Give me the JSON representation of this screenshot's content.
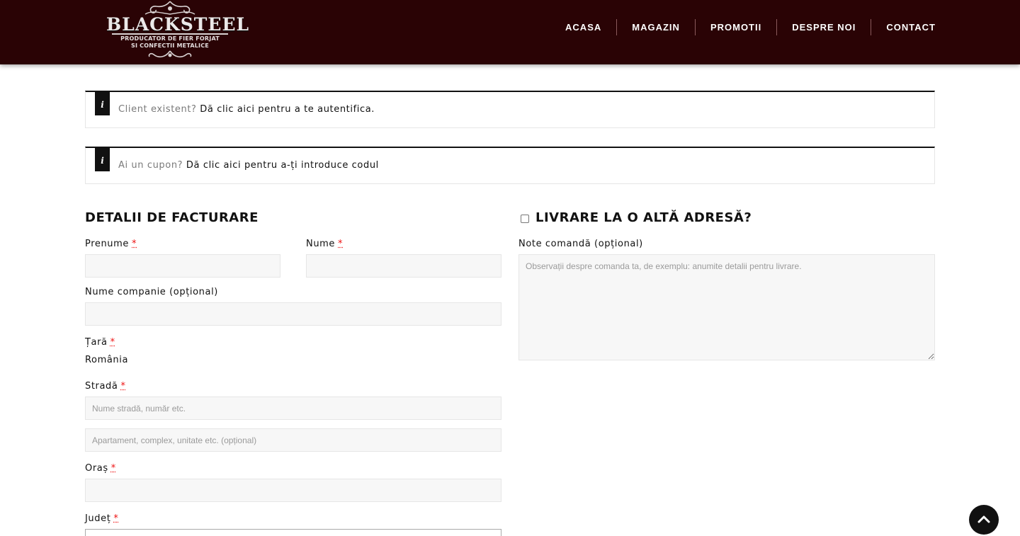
{
  "brand": {
    "name": "BLACKSTEEL",
    "tagline_line1": "PRODUCATOR DE FIER FORJAT",
    "tagline_line2": "SI CONFECTII METALICE",
    "header_bg": "#2a0305"
  },
  "nav": {
    "items": [
      {
        "label": "ACASA"
      },
      {
        "label": "MAGAZIN"
      },
      {
        "label": "PROMOTII"
      },
      {
        "label": "DESPRE NOI"
      },
      {
        "label": "CONTACT"
      }
    ]
  },
  "notices": {
    "login": {
      "icon": "i",
      "muted": "Client existent?",
      "link": "Dă clic aici pentru a te autentifica."
    },
    "coupon": {
      "icon": "i",
      "muted": "Ai un cupon?",
      "link": "Dă clic aici pentru a-ți introduce codul"
    }
  },
  "billing": {
    "title": "DETALII DE FACTURARE",
    "required_mark": "*",
    "first_name_label": "Prenume",
    "last_name_label": "Nume",
    "company_label": "Nume companie (opțional)",
    "country_label": "Țară",
    "country_value": "România",
    "street_label": "Stradă",
    "street_placeholder": "Nume stradă, număr etc.",
    "street2_placeholder": "Apartament, complex, unitate etc. (opțional)",
    "city_label": "Oraș",
    "county_label": "Județ"
  },
  "shipping": {
    "title": "LIVRARE LA O ALTĂ ADRESĂ?",
    "notes_label": "Note comandă (opțional)",
    "notes_placeholder": "Observații despre comanda ta, de exemplu: anumite detalii pentru livrare."
  },
  "icons": {
    "info": "info-icon",
    "scroll_top": "chevron-up-icon"
  },
  "colors": {
    "required": "#ee1111",
    "field_bg": "#f7f7f7"
  }
}
